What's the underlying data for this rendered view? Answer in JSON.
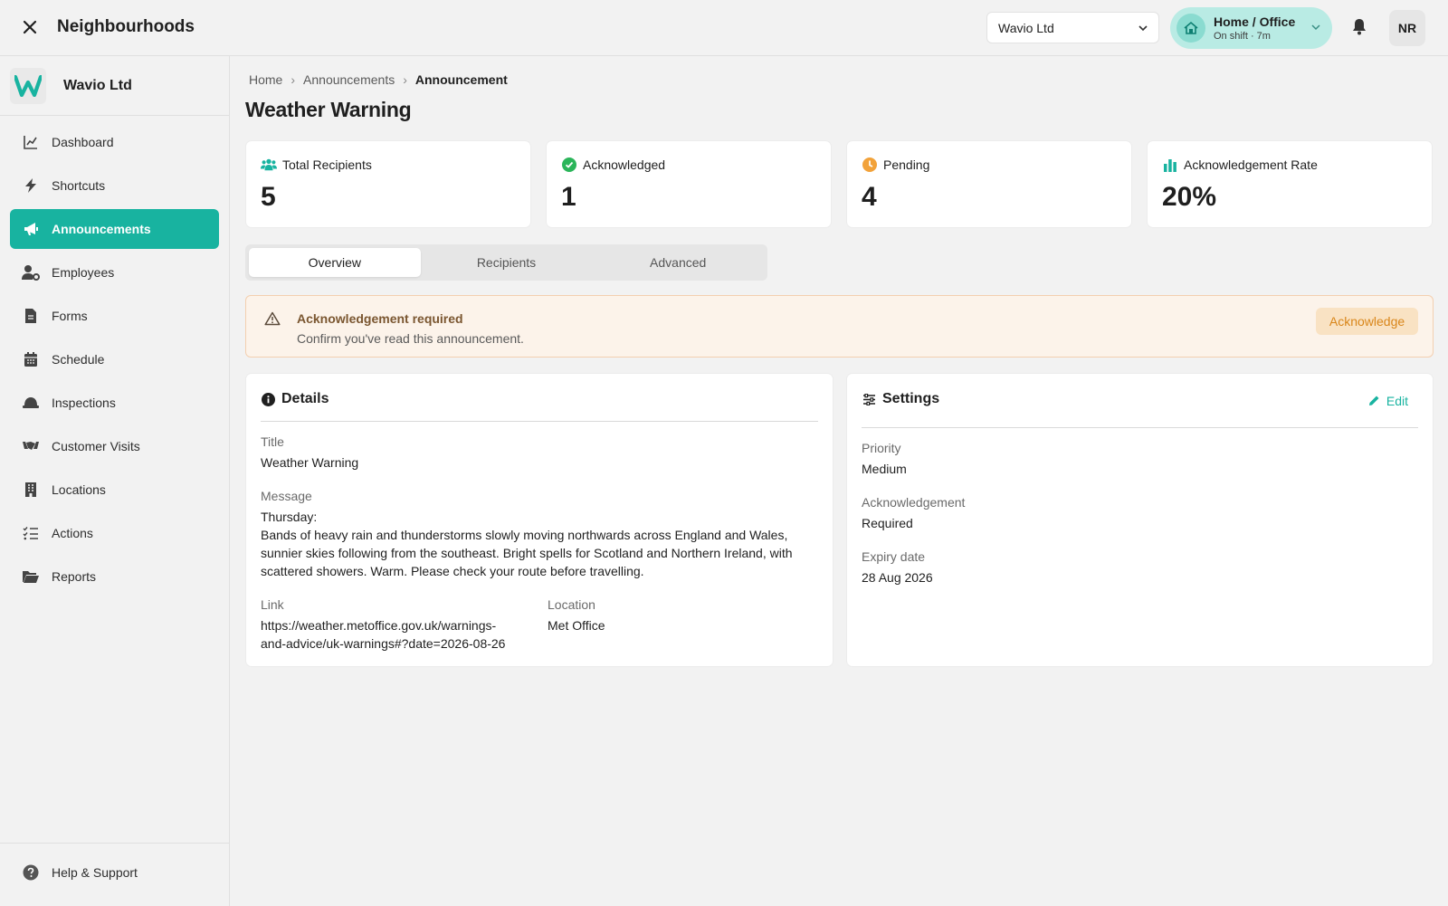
{
  "app": {
    "title": "Neighbourhoods"
  },
  "topbar": {
    "org_selected": "Wavio Ltd",
    "shift": {
      "title": "Home / Office",
      "subtitle": "On shift · 7m"
    },
    "avatar_initials": "NR"
  },
  "sidebar": {
    "org_name": "Wavio Ltd",
    "items": [
      {
        "label": "Dashboard",
        "icon": "chart-line-icon",
        "active": false
      },
      {
        "label": "Shortcuts",
        "icon": "bolt-icon",
        "active": false
      },
      {
        "label": "Announcements",
        "icon": "megaphone-icon",
        "active": true
      },
      {
        "label": "Employees",
        "icon": "user-gear-icon",
        "active": false
      },
      {
        "label": "Forms",
        "icon": "file-icon",
        "active": false
      },
      {
        "label": "Schedule",
        "icon": "calendar-icon",
        "active": false
      },
      {
        "label": "Inspections",
        "icon": "hard-hat-icon",
        "active": false
      },
      {
        "label": "Customer Visits",
        "icon": "handshake-icon",
        "active": false
      },
      {
        "label": "Locations",
        "icon": "building-icon",
        "active": false
      },
      {
        "label": "Actions",
        "icon": "list-check-icon",
        "active": false
      },
      {
        "label": "Reports",
        "icon": "folder-open-icon",
        "active": false
      }
    ],
    "help_label": "Help & Support"
  },
  "breadcrumb": {
    "home": "Home",
    "section": "Announcements",
    "current": "Announcement"
  },
  "page_title": "Weather Warning",
  "stats": [
    {
      "label": "Total Recipients",
      "value": "5",
      "icon": "users-icon",
      "color": "#18b3a0"
    },
    {
      "label": "Acknowledged",
      "value": "1",
      "icon": "check-circle-icon",
      "color": "#2bb55a"
    },
    {
      "label": "Pending",
      "value": "4",
      "icon": "clock-icon",
      "color": "#f2a23a"
    },
    {
      "label": "Acknowledgement Rate",
      "value": "20%",
      "icon": "bar-chart-icon",
      "color": "#18b3a0"
    }
  ],
  "tabs": [
    {
      "label": "Overview",
      "active": true
    },
    {
      "label": "Recipients",
      "active": false
    },
    {
      "label": "Advanced",
      "active": false
    }
  ],
  "alert": {
    "title": "Acknowledgement required",
    "message": "Confirm you've read this announcement.",
    "button": "Acknowledge"
  },
  "details": {
    "heading": "Details",
    "title_label": "Title",
    "title_value": "Weather Warning",
    "message_label": "Message",
    "message_line1": "Thursday:",
    "message_line2": "Bands of heavy rain and thunderstorms slowly moving northwards across England and Wales,",
    "message_line3": "sunnier skies following from the southeast. Bright spells for Scotland and Northern Ireland, with",
    "message_line4": "scattered showers. Warm. Please check your route before travelling.",
    "link_label": "Link",
    "link_line1": "https://weather.metoffice.gov.uk/warnings-",
    "link_line2": "and-advice/uk-warnings#?date=2026-08-26",
    "location_label": "Location",
    "location_value": "Met Office"
  },
  "settings": {
    "heading": "Settings",
    "edit_label": "Edit",
    "priority_label": "Priority",
    "priority_value": "Medium",
    "ack_label": "Acknowledgement",
    "ack_value": "Required",
    "expiry_label": "Expiry date",
    "expiry_value": "28 Aug 2026"
  },
  "colors": {
    "accent": "#18b3a0",
    "alert_bg": "#fcf3ea",
    "alert_border": "#f3cfb0",
    "ack_text": "#d9861a"
  }
}
